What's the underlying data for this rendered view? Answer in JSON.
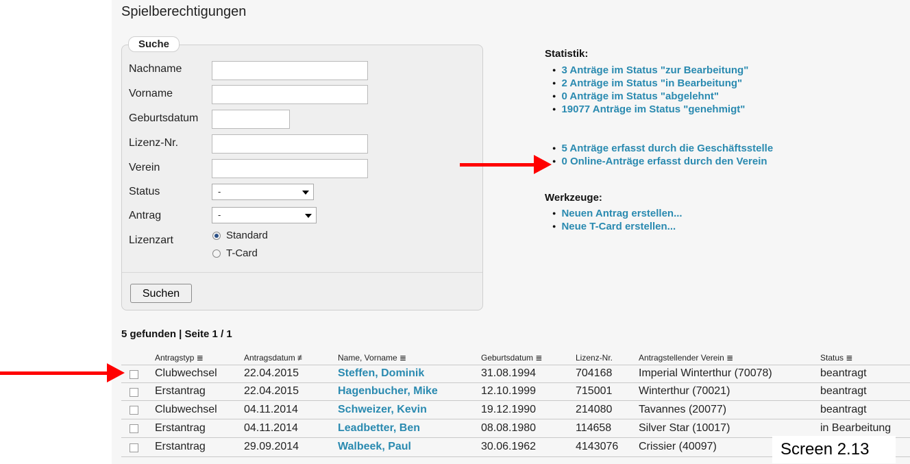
{
  "page_title": "Spielberechtigungen",
  "search": {
    "legend": "Suche",
    "fields": [
      {
        "label": "Nachname",
        "value": ""
      },
      {
        "label": "Vorname",
        "value": ""
      },
      {
        "label": "Geburtsdatum",
        "value": ""
      },
      {
        "label": "Lizenz-Nr.",
        "value": ""
      },
      {
        "label": "Verein",
        "value": ""
      }
    ],
    "status_label": "Status",
    "status_value": "-",
    "antrag_label": "Antrag",
    "antrag_value": "-",
    "lizenzart_label": "Lizenzart",
    "lizenzart_options": [
      "Standard",
      "T-Card"
    ],
    "lizenzart_selected": "Standard",
    "submit_label": "Suchen"
  },
  "statistik": {
    "heading": "Statistik:",
    "links": [
      "3 Anträge im Status \"zur Bearbeitung\"",
      "2 Anträge im Status \"in Bearbeitung\"",
      "0 Anträge im Status \"abgelehnt\"",
      "19077 Anträge im Status \"genehmigt\""
    ],
    "links2": [
      "5 Anträge erfasst durch die Geschäftsstelle",
      "0 Online-Anträge erfasst durch den Verein"
    ]
  },
  "werkzeuge": {
    "heading": "Werkzeuge:",
    "links": [
      "Neuen Antrag erstellen...",
      "Neue T-Card erstellen..."
    ]
  },
  "results": {
    "summary": "5 gefunden | Seite 1 / 1",
    "headers": [
      "Antragstyp ≣",
      "Antragsdatum ≢",
      "Name, Vorname ≣",
      "Geburtsdatum ≣",
      "Lizenz-Nr.",
      "Antragstellender Verein ≣",
      "Status ≣"
    ],
    "rows": [
      [
        "Clubwechsel",
        "22.04.2015",
        "Steffen, Dominik",
        "31.08.1994",
        "704168",
        "Imperial Winterthur (70078)",
        "beantragt"
      ],
      [
        "Erstantrag",
        "22.04.2015",
        "Hagenbucher, Mike",
        "12.10.1999",
        "715001",
        "Winterthur (70021)",
        "beantragt"
      ],
      [
        "Clubwechsel",
        "04.11.2014",
        "Schweizer, Kevin",
        "19.12.1990",
        "214080",
        "Tavannes (20077)",
        "beantragt"
      ],
      [
        "Erstantrag",
        "04.11.2014",
        "Leadbetter, Ben",
        "08.08.1980",
        "114658",
        "Silver Star (10017)",
        "in Bearbeitung"
      ],
      [
        "Erstantrag",
        "29.09.2014",
        "Walbeek, Paul",
        "30.06.1962",
        "4143076",
        "Crissier (40097)",
        ""
      ]
    ]
  },
  "screen_label": "Screen 2.13",
  "colors": {
    "link": "#2a8ab0",
    "arrow": "#ff0000",
    "panel": "#f6f6f6"
  }
}
